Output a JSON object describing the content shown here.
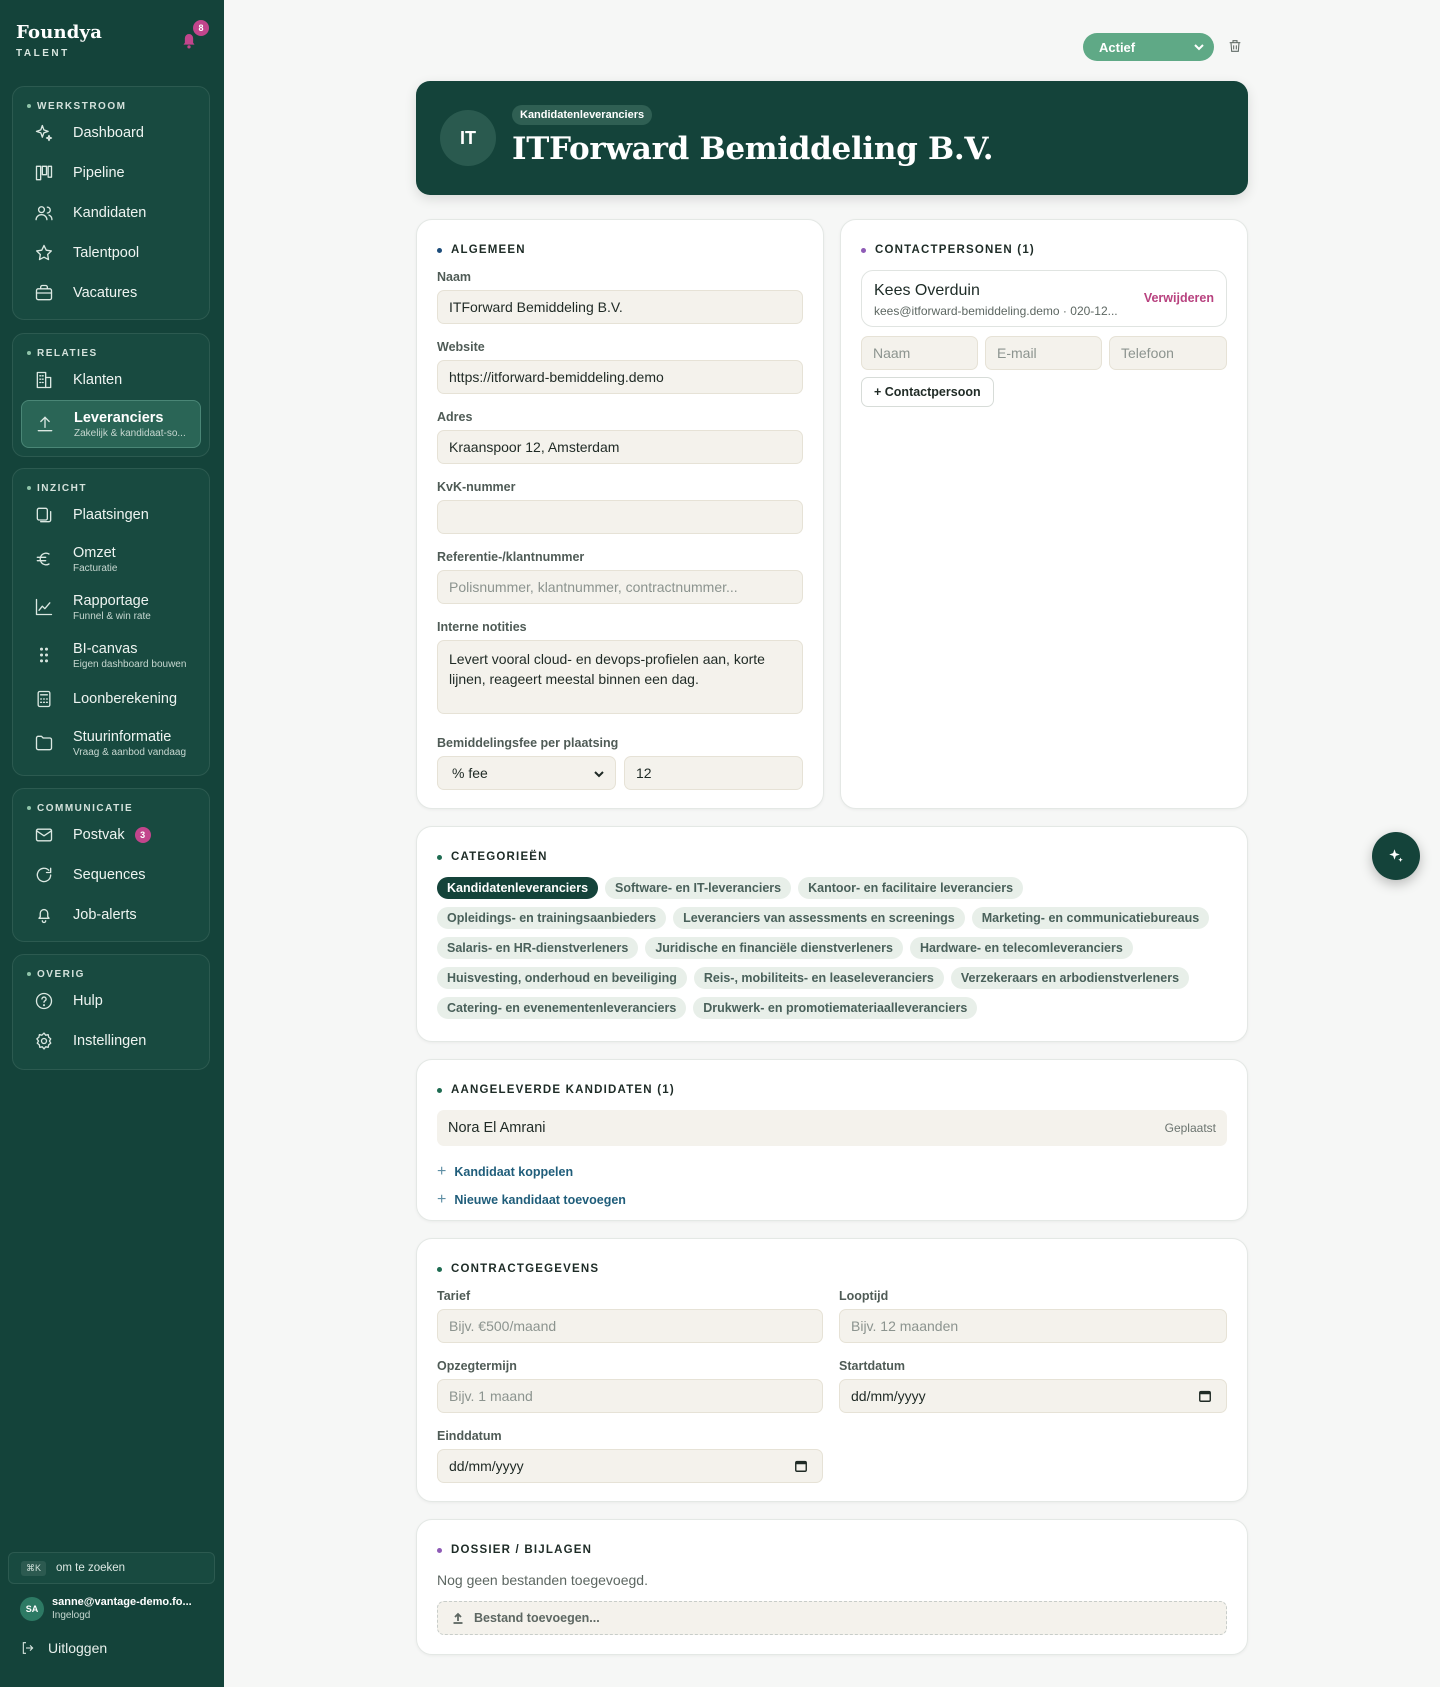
{
  "brand": {
    "name": "Foundya",
    "sub": "TALENT",
    "notifications": "8"
  },
  "nav": {
    "werkstroom": {
      "title": "WERKSTROOM",
      "items": [
        "Dashboard",
        "Pipeline",
        "Kandidaten",
        "Talentpool",
        "Vacatures"
      ]
    },
    "relaties": {
      "title": "RELATIES",
      "klanten": "Klanten",
      "leveranciers": "Leveranciers",
      "leveranciers_sub": "Zakelijk & kandidaat-so..."
    },
    "inzicht": {
      "title": "INZICHT",
      "plaatsingen": "Plaatsingen",
      "omzet": "Omzet",
      "omzet_sub": "Facturatie",
      "rapportage": "Rapportage",
      "rapportage_sub": "Funnel & win rate",
      "bi": "BI-canvas",
      "bi_sub": "Eigen dashboard bouwen",
      "loon": "Loonberekening",
      "stuur": "Stuurinformatie",
      "stuur_sub": "Vraag & aanbod vandaag"
    },
    "communicatie": {
      "title": "COMMUNICATIE",
      "postvak": "Postvak",
      "postvak_badge": "3",
      "sequences": "Sequences",
      "jobalerts": "Job-alerts"
    },
    "overig": {
      "title": "OVERIG",
      "hulp": "Hulp",
      "instellingen": "Instellingen"
    }
  },
  "search": {
    "kbd": "⌘K",
    "label": "om te zoeken"
  },
  "user": {
    "initials": "SA",
    "email": "sanne@vantage-demo.fo...",
    "status": "Ingelogd"
  },
  "logout": "Uitloggen",
  "status": {
    "value": "Actief",
    "color": "#5fa986"
  },
  "hero": {
    "initials": "IT",
    "tag": "Kandidatenleveranciers",
    "title": "ITForward Bemiddeling B.V."
  },
  "algemeen": {
    "title": "ALGEMEEN",
    "naam_label": "Naam",
    "naam": "ITForward Bemiddeling B.V.",
    "website_label": "Website",
    "website": "https://itforward-bemiddeling.demo",
    "adres_label": "Adres",
    "adres": "Kraanspoor 12, Amsterdam",
    "kvk_label": "KvK-nummer",
    "kvk": "",
    "ref_label": "Referentie-/klantnummer",
    "ref_placeholder": "Polisnummer, klantnummer, contractnummer...",
    "notities_label": "Interne notities",
    "notities": "Levert vooral cloud- en devops-profielen aan, korte lijnen, reageert meestal binnen een dag.",
    "fee_label": "Bemiddelingsfee per plaatsing",
    "fee_type": "% fee",
    "fee_value": "12"
  },
  "contacts": {
    "title": "CONTACTPERSONEN (1)",
    "name": "Kees Overduin",
    "detail": "kees@itforward-bemiddeling.demo · 020-12...",
    "remove": "Verwijderen",
    "naam_ph": "Naam",
    "email_ph": "E-mail",
    "tel_ph": "Telefoon",
    "add": "+ Contactpersoon"
  },
  "categories": {
    "title": "CATEGORIEËN",
    "items": [
      "Kandidatenleveranciers",
      "Software- en IT-leveranciers",
      "Kantoor- en facilitaire leveranciers",
      "Opleidings- en trainingsaanbieders",
      "Leveranciers van assessments en screenings",
      "Marketing- en communicatiebureaus",
      "Salaris- en HR-dienstverleners",
      "Juridische en financiële dienstverleners",
      "Hardware- en telecomleveranciers",
      "Huisvesting, onderhoud en beveiliging",
      "Reis-, mobiliteits- en leaseleveranciers",
      "Verzekeraars en arbodienstverleners",
      "Catering- en evenementenleveranciers",
      "Drukwerk- en promotiemateriaalleveranciers"
    ]
  },
  "candidates": {
    "title": "AANGELEVERDE KANDIDATEN (1)",
    "name": "Nora El Amrani",
    "status": "Geplaatst",
    "link_koppelen": "Kandidaat koppelen",
    "link_nieuw": "Nieuwe kandidaat toevoegen"
  },
  "contract": {
    "title": "CONTRACTGEGEVENS",
    "tarief_label": "Tarief",
    "tarief_ph": "Bijv. €500/maand",
    "looptijd_label": "Looptijd",
    "looptijd_ph": "Bijv. 12 maanden",
    "opzeg_label": "Opzegtermijn",
    "opzeg_ph": "Bijv. 1 maand",
    "start_label": "Startdatum",
    "start": "dd/mm/yyyy",
    "eind_label": "Einddatum",
    "eind": "dd/mm/yyyy"
  },
  "dossier": {
    "title": "DOSSIER / BIJLAGEN",
    "empty": "Nog geen bestanden toegevoegd.",
    "upload": "Bestand toevoegen..."
  }
}
